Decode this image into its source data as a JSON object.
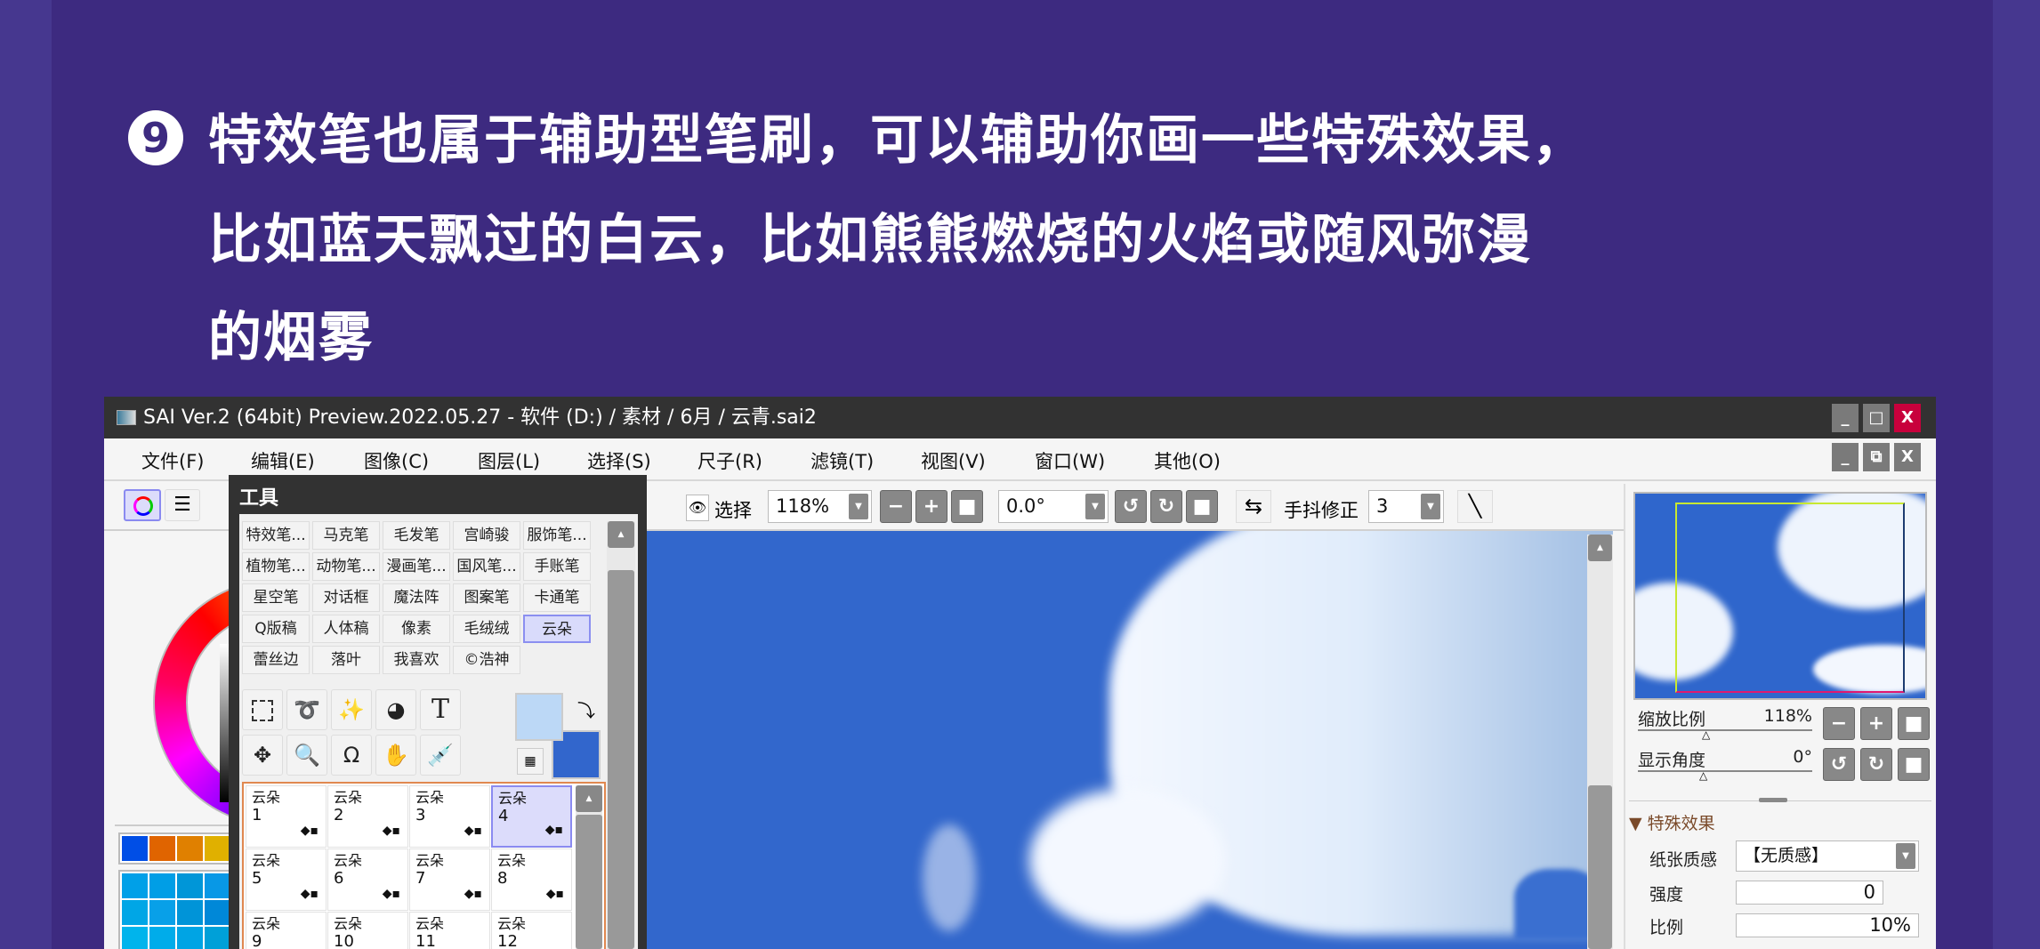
{
  "headline": {
    "number": "9",
    "line1": "特效笔也属于辅助型笔刷，可以辅助你画一些特殊效果，",
    "line2": "比如蓝天飘过的白云，比如熊熊燃烧的火焰或随风弥漫",
    "line3": "的烟雾"
  },
  "window": {
    "title": "SAI Ver.2 (64bit) Preview.2022.05.27 - 软件 (D:) / 素材 / 6月 / 云青.sai2",
    "min": "_",
    "max": "□",
    "close": "X",
    "restore": "⧉"
  },
  "menu": [
    "文件(F)",
    "编辑(E)",
    "图像(C)",
    "图层(L)",
    "选择(S)",
    "尺子(R)",
    "滤镜(T)",
    "视图(V)",
    "窗口(W)",
    "其他(O)"
  ],
  "toolbar": {
    "select_label": "选择",
    "zoom": "118%",
    "angle": "0.0°",
    "stabilizer_label": "手抖修正",
    "stabilizer": "3"
  },
  "tool_window": {
    "title": "工具",
    "brush_groups": [
      [
        "特效笔...",
        "马克笔",
        "毛发笔",
        "宫崎骏",
        "服饰笔..."
      ],
      [
        "植物笔...",
        "动物笔...",
        "漫画笔...",
        "国风笔...",
        "手账笔"
      ],
      [
        "星空笔",
        "对话框",
        "魔法阵",
        "图案笔",
        "卡通笔"
      ],
      [
        "Q版稿",
        "人体稿",
        "像素",
        "毛绒绒",
        "云朵"
      ],
      [
        "蕾丝边",
        "落叶",
        "我喜欢",
        "©浩神"
      ]
    ],
    "selected_group": "云朵",
    "slots": [
      {
        "name": "云朵",
        "n": "1"
      },
      {
        "name": "云朵",
        "n": "2"
      },
      {
        "name": "云朵",
        "n": "3"
      },
      {
        "name": "云朵",
        "n": "4"
      },
      {
        "name": "云朵",
        "n": "5"
      },
      {
        "name": "云朵",
        "n": "6"
      },
      {
        "name": "云朵",
        "n": "7"
      },
      {
        "name": "云朵",
        "n": "8"
      },
      {
        "name": "云朵",
        "n": "9"
      },
      {
        "name": "云朵",
        "n": "10"
      },
      {
        "name": "云朵",
        "n": "11"
      },
      {
        "name": "云朵",
        "n": "12"
      }
    ],
    "selected_slot": "4",
    "text_tool": "T"
  },
  "colors": {
    "foreground": "#bcd8f6",
    "background": "#3266cc",
    "accent": "#8a8af0",
    "bg_page": "#3d2a80",
    "palette": [
      "#004ee6",
      "#e06400",
      "#e08000",
      "#e0b000"
    ],
    "grid": [
      "#00a0e8",
      "#009ee6",
      "#0096d8",
      "#0898e6",
      "#00a6e6",
      "#08a0e8",
      "#0094d8",
      "#0088d8",
      "#00b4ec",
      "#00acea",
      "#00a4e4",
      "#00a0d8"
    ]
  },
  "navigator": {
    "zoom_label": "缩放比例",
    "zoom": "118%",
    "angle_label": "显示角度",
    "angle": "0°"
  },
  "effects": {
    "section": "特殊效果",
    "paper_label": "纸张质感",
    "paper": "【无质感】",
    "strength_label": "强度",
    "strength": "0",
    "scale_label": "比例",
    "scale": "10%"
  }
}
